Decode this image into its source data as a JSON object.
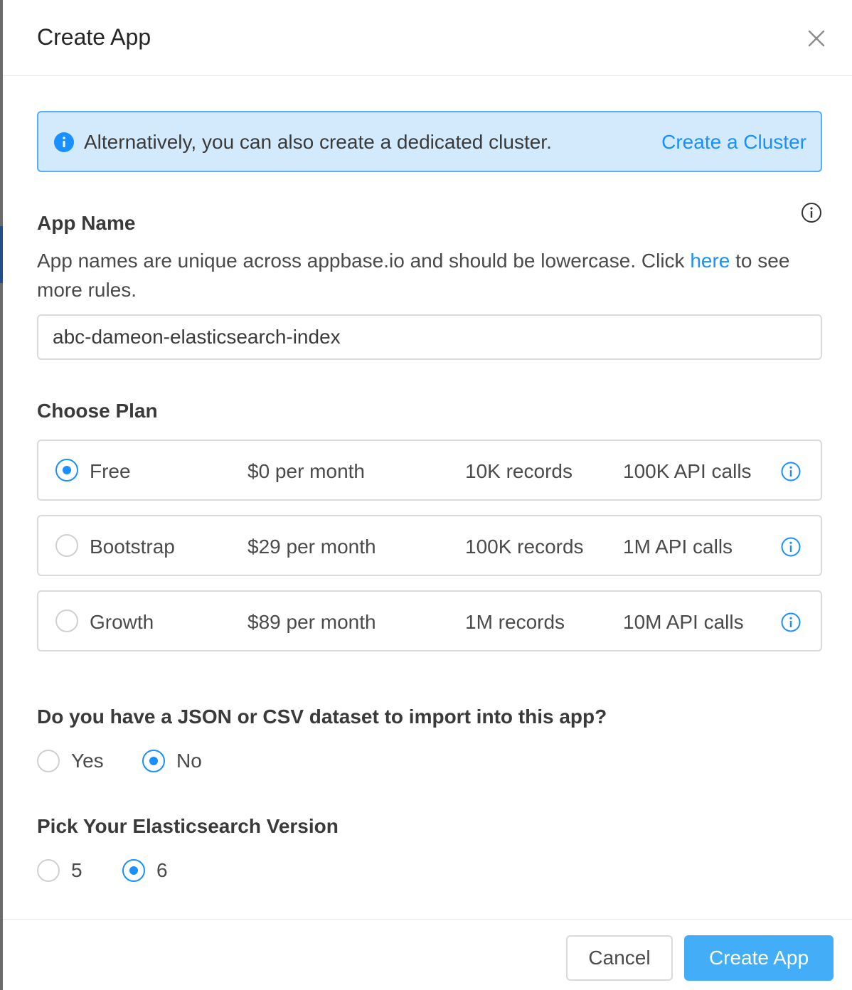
{
  "modal": {
    "title": "Create App",
    "close_icon": "close-icon"
  },
  "alert": {
    "icon": "info-filled-icon",
    "text": "Alternatively, you can also create a dedicated cluster.",
    "link": "Create a Cluster"
  },
  "app_name": {
    "heading": "App Name",
    "help_icon": "info-outline-icon",
    "desc_before": "App names are unique across appbase.io and should be lowercase. Click ",
    "desc_link": "here",
    "desc_after": " to see more rules.",
    "value": "abc-dameon-elasticsearch-index"
  },
  "plan": {
    "heading": "Choose Plan",
    "options": [
      {
        "name": "Free",
        "price": "$0 per month",
        "records": "10K records",
        "calls": "100K API calls",
        "selected": true
      },
      {
        "name": "Bootstrap",
        "price": "$29 per month",
        "records": "100K records",
        "calls": "1M API calls",
        "selected": false
      },
      {
        "name": "Growth",
        "price": "$89 per month",
        "records": "1M records",
        "calls": "10M API calls",
        "selected": false
      }
    ]
  },
  "dataset": {
    "question": "Do you have a JSON or CSV dataset to import into this app?",
    "options": [
      {
        "label": "Yes",
        "selected": false
      },
      {
        "label": "No",
        "selected": true
      }
    ]
  },
  "es_version": {
    "heading": "Pick Your Elasticsearch Version",
    "options": [
      {
        "label": "5",
        "selected": false
      },
      {
        "label": "6",
        "selected": true
      }
    ]
  },
  "footer": {
    "cancel": "Cancel",
    "create": "Create App"
  },
  "colors": {
    "accent": "#1890ff",
    "alert_bg": "#d3eafd",
    "alert_border": "#5aaef3",
    "primary_button": "#43adf7"
  }
}
